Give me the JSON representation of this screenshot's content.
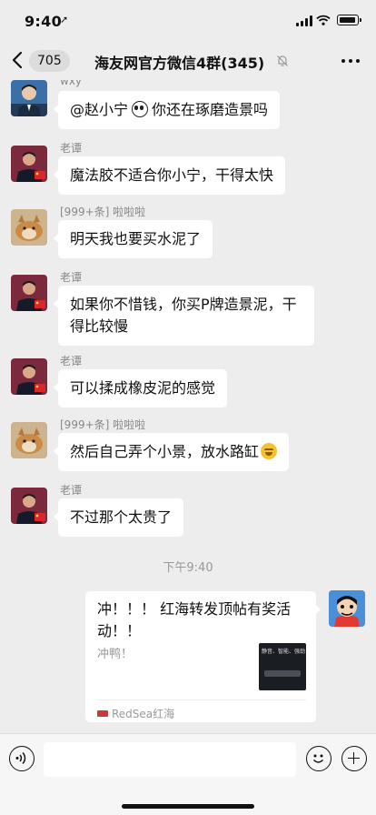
{
  "status_bar": {
    "time": "9:40",
    "location_glyph": "➚"
  },
  "nav": {
    "back_count": "705",
    "title": "海友网官方微信4群(345)",
    "icons": [
      "chevron-left-icon",
      "bell-mute-icon",
      "more-icon"
    ]
  },
  "messages": [
    {
      "sender": "wxy",
      "text_before": "@赵小宁",
      "text_after": "你还在琢磨造景吗",
      "avatar": "man-in-suit-photo"
    },
    {
      "sender": "老谭",
      "text": "魔法胶不适合你小宁，干得太快",
      "avatar": "speaker-with-flag-photo"
    },
    {
      "sender": "[999+条]  啦啦啦",
      "text": "明天我也要买水泥了",
      "avatar": "shiba-dog-photo"
    },
    {
      "sender": "老谭",
      "text": "如果你不惜钱，你买P牌造景泥，干得比较慢",
      "avatar": "speaker-with-flag-photo"
    },
    {
      "sender": "老谭",
      "text": "可以揉成橡皮泥的感觉",
      "avatar": "speaker-with-flag-photo"
    },
    {
      "sender": "[999+条]  啦啦啦",
      "text": "然后自己弄个小景，放水路缸",
      "avatar": "shiba-dog-photo"
    },
    {
      "sender": "老谭",
      "text": "不过那个太贵了",
      "avatar": "speaker-with-flag-photo"
    }
  ],
  "time_separator": "下午9:40",
  "link_card": {
    "title": "冲！！！ 红海转发顶帖有奖活动！！",
    "description": "冲鸭！",
    "thumbnail_text": "静音、智能、强劲",
    "source": "RedSea红海"
  },
  "input_bar": {
    "value": ""
  }
}
